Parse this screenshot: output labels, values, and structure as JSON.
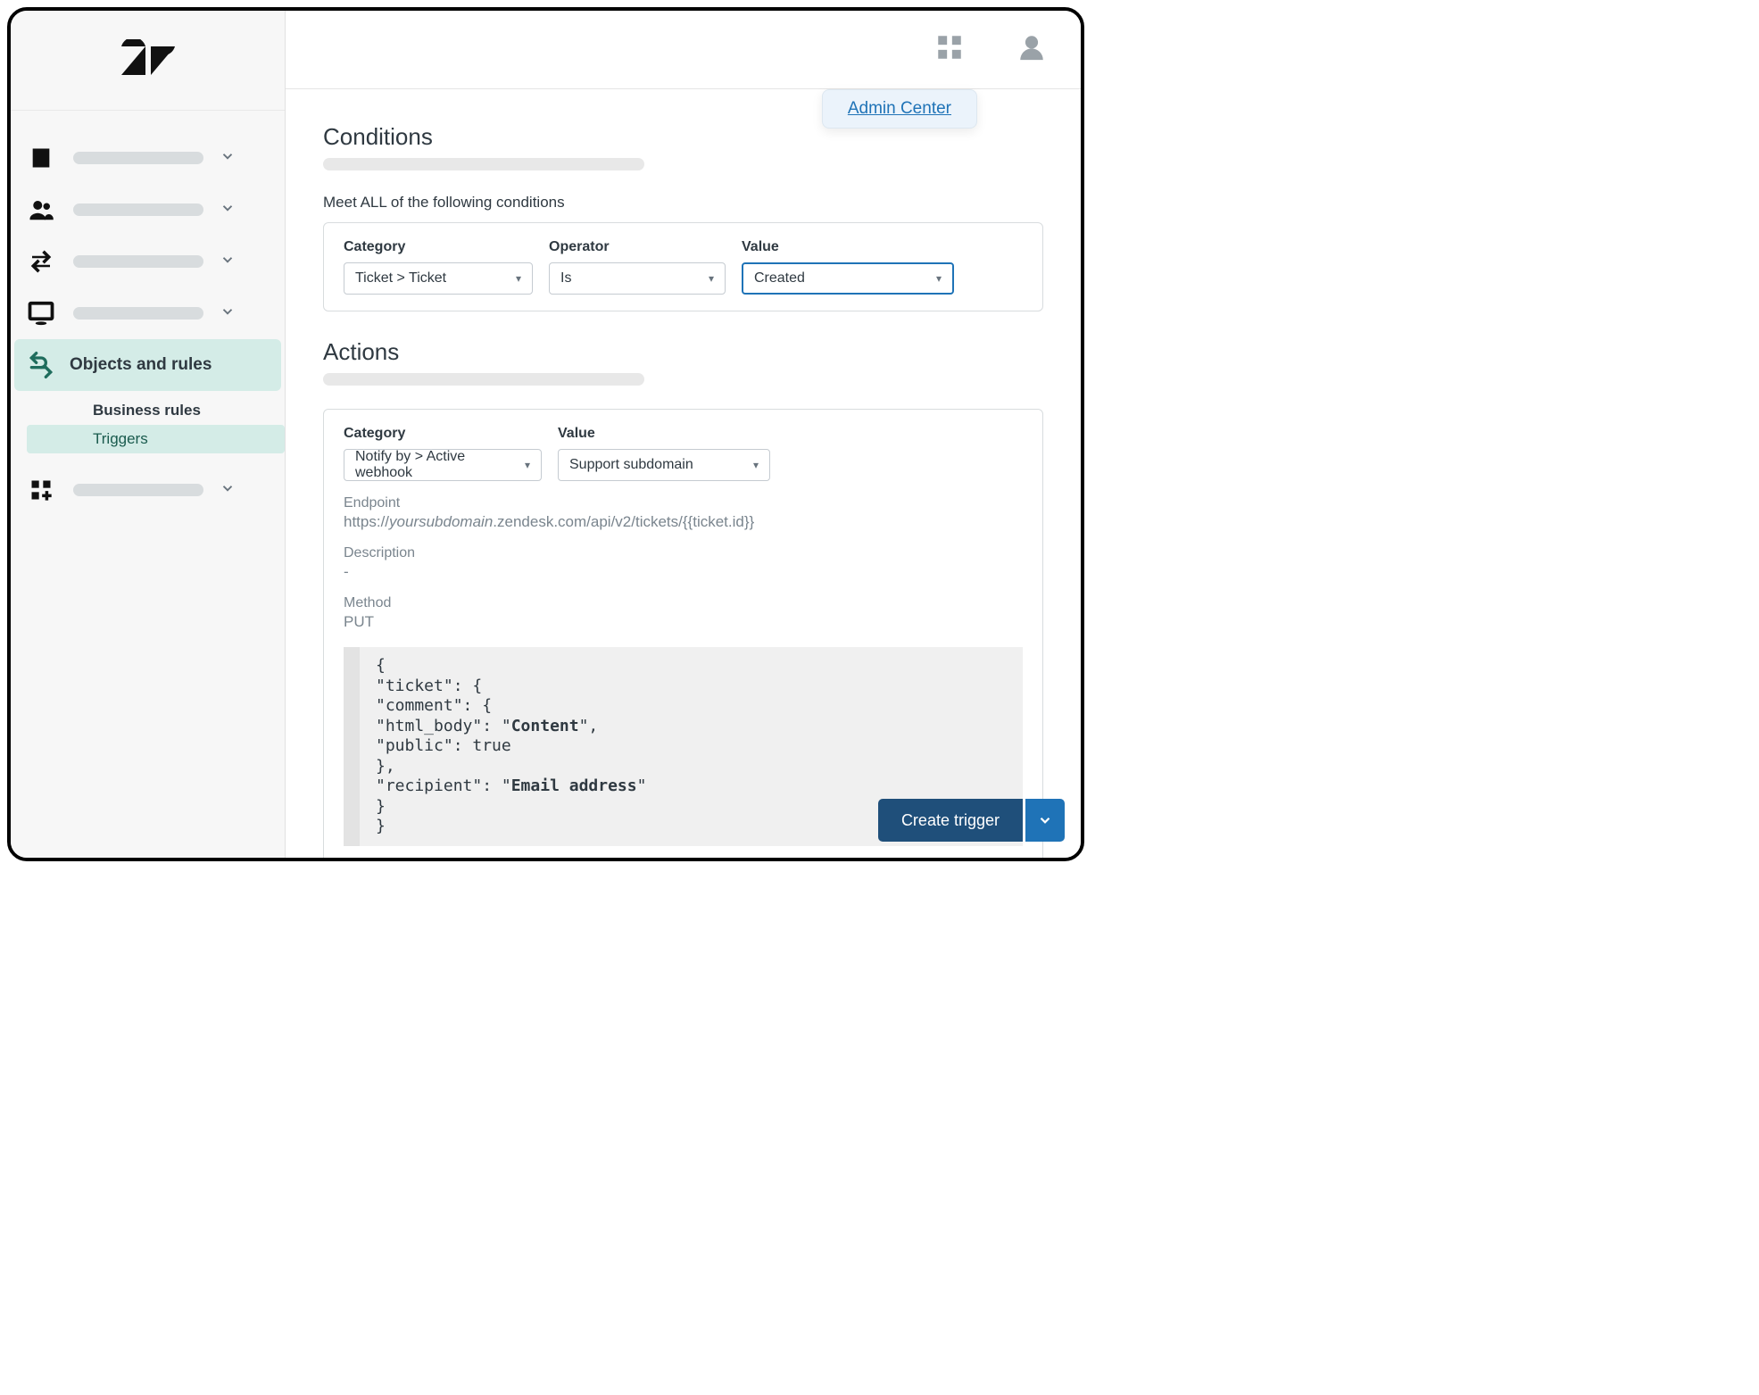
{
  "topbar": {
    "popover_link": "Admin Center"
  },
  "sidebar": {
    "active_label": "Objects and rules",
    "sub": {
      "header": "Business rules",
      "selected": "Triggers"
    }
  },
  "conditions": {
    "heading": "Conditions",
    "meet_all": "Meet ALL of the following conditions",
    "labels": {
      "category": "Category",
      "operator": "Operator",
      "value": "Value"
    },
    "values": {
      "category": "Ticket > Ticket",
      "operator": "Is",
      "value": "Created"
    }
  },
  "actions": {
    "heading": "Actions",
    "labels": {
      "category": "Category",
      "value": "Value"
    },
    "values": {
      "category": "Notify by > Active webhook",
      "value": "Support subdomain"
    },
    "endpoint_label": "Endpoint",
    "endpoint_prefix": "https://",
    "endpoint_sub": "yoursubdomain",
    "endpoint_rest": ".zendesk.com/api/v2/tickets/{{ticket.id}}",
    "description_label": "Description",
    "description_value": "-",
    "method_label": "Method",
    "method_value": "PUT",
    "code": {
      "l1": "{",
      "l2": "\"ticket\": {",
      "l3": "\"comment\": {",
      "l4a": "\"html_body\": \"",
      "l4b": "Content",
      "l4c": "\",",
      "l5": "\"public\": true",
      "l6": "},",
      "l7a": "\"recipient\": \"",
      "l7b": "Email address",
      "l7c": "\"",
      "l8": "}",
      "l9": "}"
    }
  },
  "footer": {
    "create": "Create trigger"
  }
}
